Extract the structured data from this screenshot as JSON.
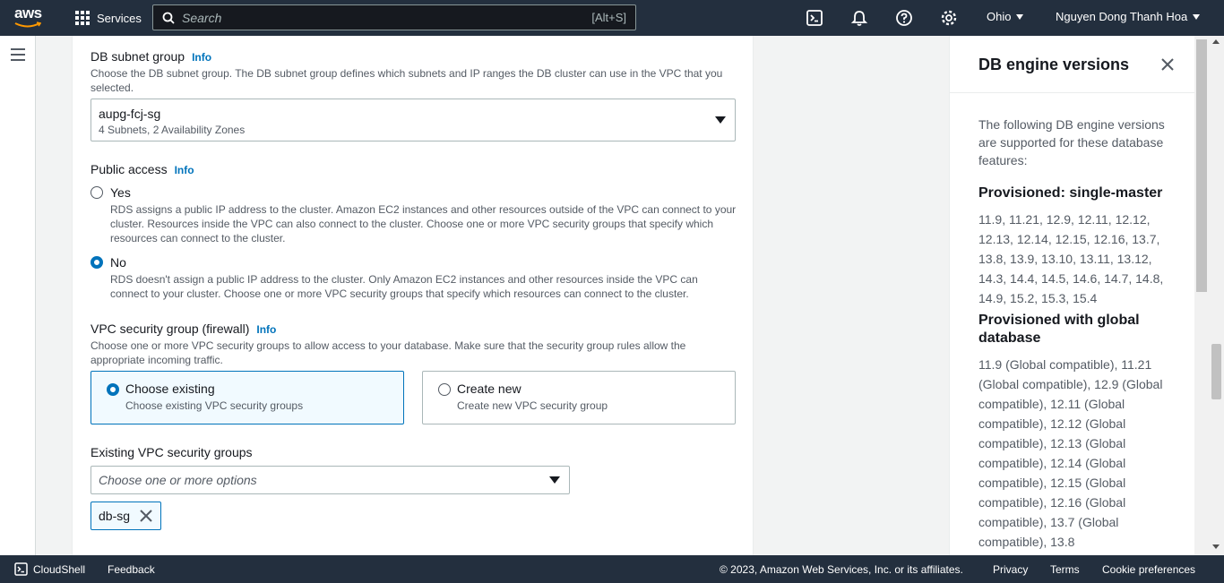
{
  "topnav": {
    "logo_text": "aws",
    "services_label": "Services",
    "search_placeholder": "Search",
    "search_shortcut": "[Alt+S]",
    "region": "Ohio",
    "user": "Nguyen Dong Thanh Hoa"
  },
  "subnet_group": {
    "label": "DB subnet group",
    "info": "Info",
    "description": "Choose the DB subnet group. The DB subnet group defines which subnets and IP ranges the DB cluster can use in the VPC that you selected.",
    "selected_value": "aupg-fcj-sg",
    "selected_detail": "4 Subnets, 2 Availability Zones"
  },
  "public_access": {
    "label": "Public access",
    "info": "Info",
    "yes_label": "Yes",
    "yes_description": "RDS assigns a public IP address to the cluster. Amazon EC2 instances and other resources outside of the VPC can connect to your cluster. Resources inside the VPC can also connect to the cluster. Choose one or more VPC security groups that specify which resources can connect to the cluster.",
    "no_label": "No",
    "no_description": "RDS doesn't assign a public IP address to the cluster. Only Amazon EC2 instances and other resources inside the VPC can connect to your cluster. Choose one or more VPC security groups that specify which resources can connect to the cluster.",
    "selected": "No"
  },
  "vpc_sg": {
    "label": "VPC security group (firewall)",
    "info": "Info",
    "description": "Choose one or more VPC security groups to allow access to your database. Make sure that the security group rules allow the appropriate incoming traffic.",
    "choose_existing_title": "Choose existing",
    "choose_existing_desc": "Choose existing VPC security groups",
    "create_new_title": "Create new",
    "create_new_desc": "Create new VPC security group",
    "selected": "Choose existing"
  },
  "existing_sg": {
    "label": "Existing VPC security groups",
    "placeholder": "Choose one or more options",
    "tokens": [
      "db-sg"
    ]
  },
  "help_panel": {
    "title": "DB engine versions",
    "intro": "The following DB engine versions are supported for these database features:",
    "section1_title": "Provisioned: single-master",
    "section1_versions": "11.9, 11.21, 12.9, 12.11, 12.12, 12.13, 12.14, 12.15, 12.16, 13.7, 13.8, 13.9, 13.10, 13.11, 13.12, 14.3, 14.4, 14.5, 14.6, 14.7, 14.8, 14.9, 15.2, 15.3, 15.4",
    "section2_title": "Provisioned with global database",
    "section2_versions": "11.9 (Global compatible), 11.21 (Global compatible), 12.9 (Global compatible), 12.11 (Global compatible), 12.12 (Global compatible), 12.13 (Global compatible), 12.14 (Global compatible), 12.15 (Global compatible), 12.16 (Global compatible), 13.7 (Global compatible), 13.8"
  },
  "footer": {
    "cloudshell": "CloudShell",
    "feedback": "Feedback",
    "copyright": "© 2023, Amazon Web Services, Inc. or its affiliates.",
    "privacy": "Privacy",
    "terms": "Terms",
    "cookie": "Cookie preferences"
  },
  "colors": {
    "nav_bg": "#232f3e",
    "link_blue": "#0073bb",
    "selected_tile_bg": "#f1faff"
  }
}
